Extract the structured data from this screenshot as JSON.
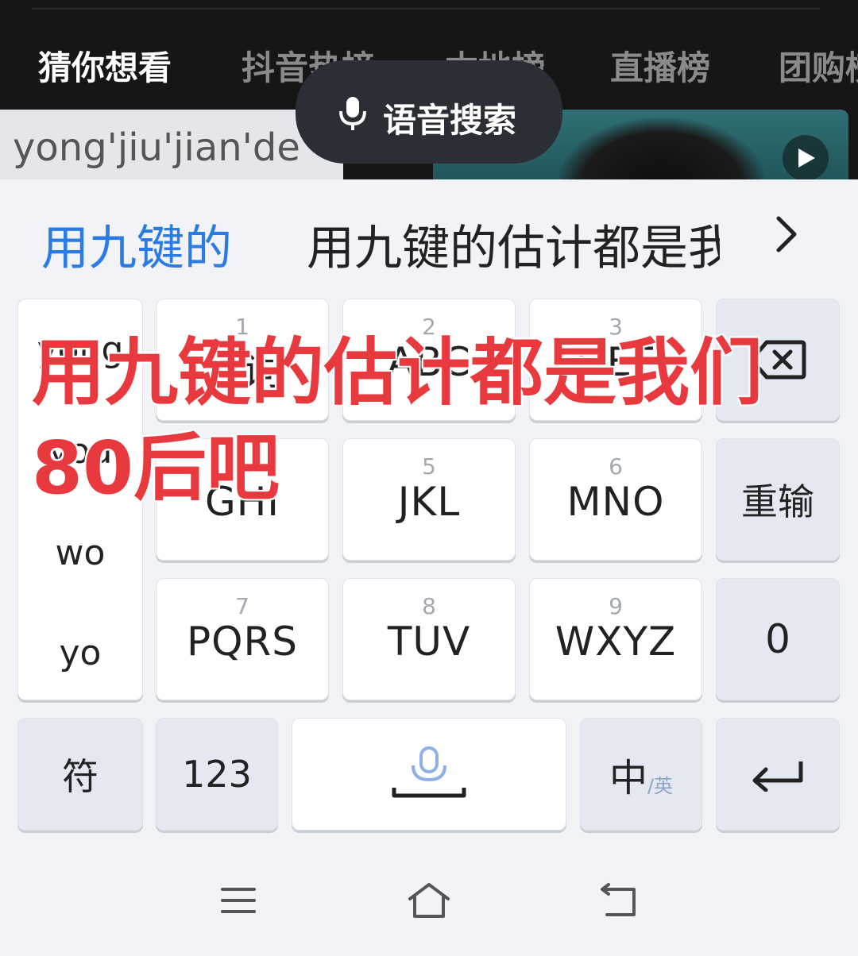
{
  "app_tabs": {
    "items": [
      {
        "label": "猜你想看",
        "active": true
      },
      {
        "label": "抖音热榜",
        "active": false
      },
      {
        "label": "本地榜",
        "active": false
      },
      {
        "label": "直播榜",
        "active": false
      },
      {
        "label": "团购榜",
        "active": false
      }
    ]
  },
  "voice_search": {
    "label": "语音搜索"
  },
  "pinyin_input": {
    "text": "yong'jiu'jian'de"
  },
  "candidates": {
    "first": "用九键的",
    "second": "用九键的估计都是我"
  },
  "keyboard": {
    "side_list": [
      "yong",
      "you",
      "wo",
      "yo"
    ],
    "keys": [
      {
        "num": "1",
        "letters": "分词"
      },
      {
        "num": "2",
        "letters": "ABC"
      },
      {
        "num": "3",
        "letters": "DEF"
      },
      {
        "num": "4",
        "letters": "GHI"
      },
      {
        "num": "5",
        "letters": "JKL"
      },
      {
        "num": "6",
        "letters": "MNO"
      },
      {
        "num": "7",
        "letters": "PQRS"
      },
      {
        "num": "8",
        "letters": "TUV"
      },
      {
        "num": "9",
        "letters": "WXYZ"
      }
    ],
    "reinput_label": "重输",
    "zero_label": "0",
    "symbol_label": "符",
    "numeric_label": "123",
    "lang_main": "中",
    "lang_sub": "/英"
  },
  "overlay_caption": "用九键的估计都是我们80后吧",
  "colors": {
    "accent_blue": "#2a7be3",
    "caption_red": "#e8393e",
    "top_bg": "#161616"
  }
}
